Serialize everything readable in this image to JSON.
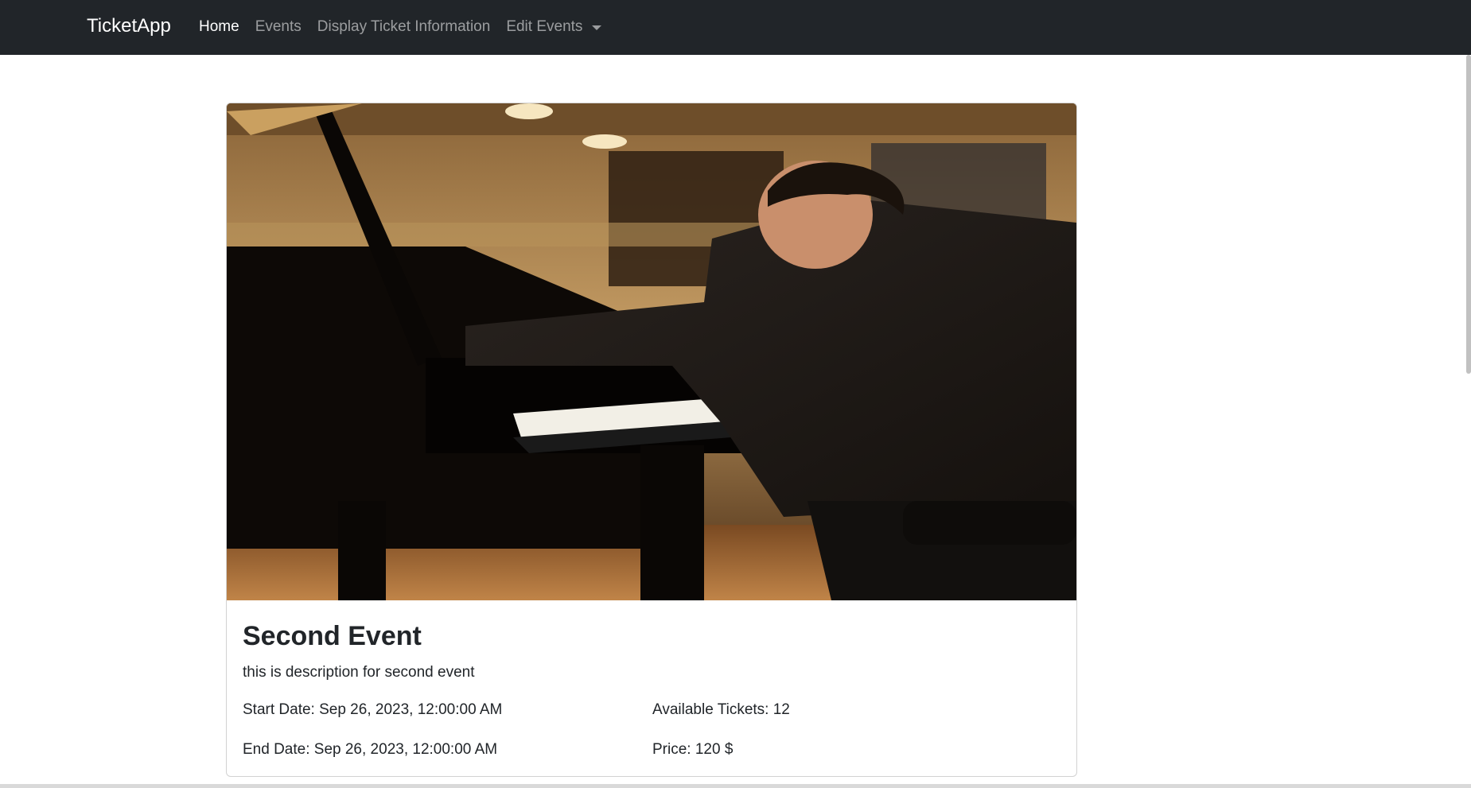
{
  "navbar": {
    "brand": "TicketApp",
    "links": [
      {
        "label": "Home"
      },
      {
        "label": "Events"
      },
      {
        "label": "Display Ticket Information"
      },
      {
        "label": "Edit Events"
      }
    ]
  },
  "event": {
    "title": "Second Event",
    "description": "this is description for second event",
    "start_date": "Start Date: Sep 26, 2023, 12:00:00 AM",
    "end_date": "End Date: Sep 26, 2023, 12:00:00 AM",
    "available_tickets": "Available Tickets: 12",
    "price": "Price: 120 $",
    "image_icon": "concert-pianist-photo"
  },
  "colors": {
    "navbar_bg": "#212529",
    "nav_active": "#ffffff",
    "nav_inactive": "rgba(255,255,255,0.55)"
  }
}
